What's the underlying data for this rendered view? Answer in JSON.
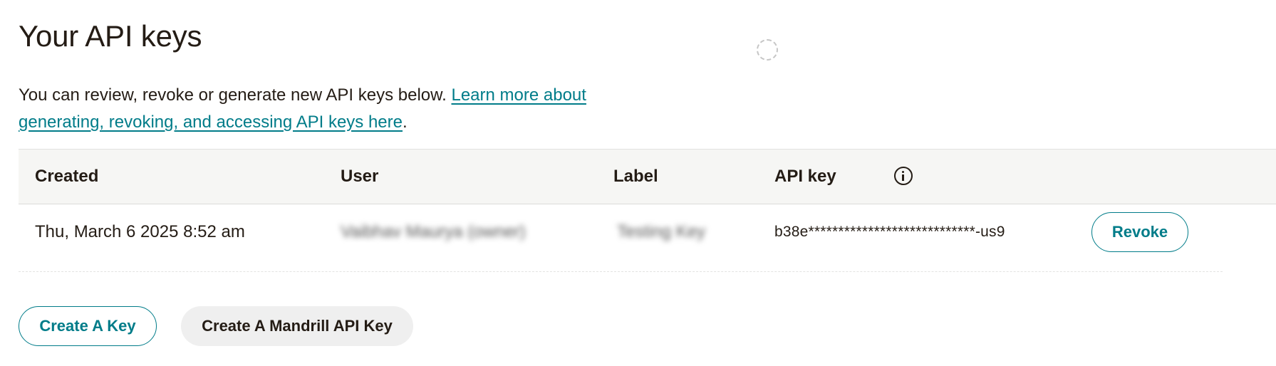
{
  "page": {
    "title": "Your API keys",
    "intro_text": "You can review, revoke or generate new API keys below. ",
    "intro_link": "Learn more about generating, revoking, and accessing API keys here",
    "intro_period": "."
  },
  "table": {
    "headers": {
      "created": "Created",
      "user": "User",
      "label": "Label",
      "api_key": "API key"
    },
    "rows": [
      {
        "created": "Thu, March 6 2025 8:52 am",
        "user": "Vaibhav Maurya (owner)",
        "label": "Testing Key",
        "api_key": "b38e****************************-us9",
        "action_label": "Revoke"
      }
    ]
  },
  "actions": {
    "create_key_label": "Create A Key",
    "create_mandrill_label": "Create A Mandrill API Key"
  },
  "icons": {
    "info": "info-circle-icon",
    "loading": "loading-spinner-icon"
  },
  "colors": {
    "accent": "#007c89",
    "text": "#241c15",
    "header_bg": "#f6f6f4",
    "secondary_button_bg": "#efefef"
  }
}
